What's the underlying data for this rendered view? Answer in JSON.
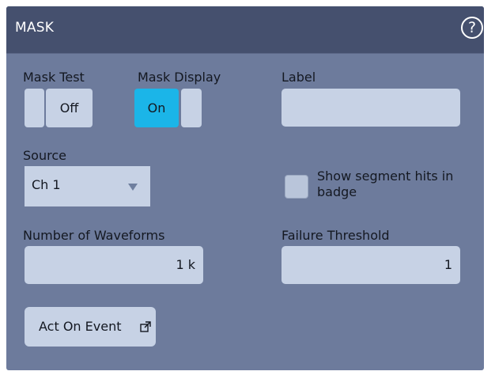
{
  "header": {
    "title": "MASK",
    "help_glyph": "?"
  },
  "mask_test": {
    "label": "Mask Test",
    "value": "Off"
  },
  "mask_display": {
    "label": "Mask Display",
    "value": "On"
  },
  "label_field": {
    "label": "Label",
    "value": ""
  },
  "source": {
    "label": "Source",
    "selected": "Ch 1",
    "icon": "chevron-down-icon"
  },
  "segment_hits": {
    "label_line1": "Show segment hits in",
    "label_line2": "badge",
    "checked": false
  },
  "num_waveforms": {
    "label": "Number of Waveforms",
    "value": "1 k"
  },
  "failure_threshold": {
    "label": "Failure Threshold",
    "value": "1"
  },
  "act_on_event": {
    "label": "Act On Event",
    "icon": "external-link-icon"
  },
  "colors": {
    "panel": "#6d7b9c",
    "header": "#45506e",
    "control": "#c7d2e5",
    "toggle_active": "#1bb5e8"
  }
}
